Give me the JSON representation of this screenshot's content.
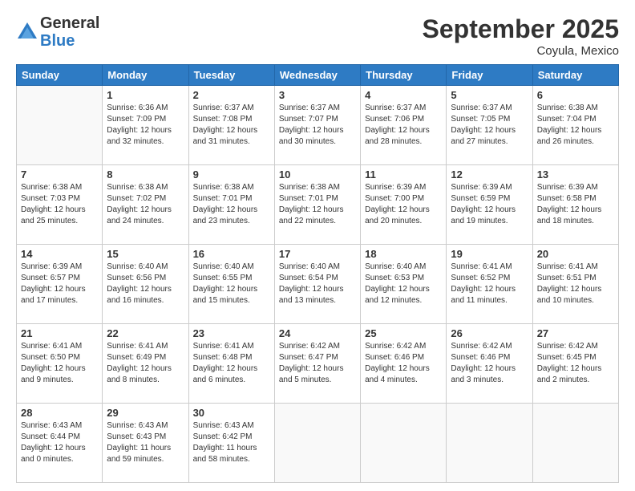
{
  "logo": {
    "general": "General",
    "blue": "Blue"
  },
  "header": {
    "month": "September 2025",
    "location": "Coyula, Mexico"
  },
  "weekdays": [
    "Sunday",
    "Monday",
    "Tuesday",
    "Wednesday",
    "Thursday",
    "Friday",
    "Saturday"
  ],
  "weeks": [
    [
      {
        "day": null,
        "info": null
      },
      {
        "day": "1",
        "info": "Sunrise: 6:36 AM\nSunset: 7:09 PM\nDaylight: 12 hours\nand 32 minutes."
      },
      {
        "day": "2",
        "info": "Sunrise: 6:37 AM\nSunset: 7:08 PM\nDaylight: 12 hours\nand 31 minutes."
      },
      {
        "day": "3",
        "info": "Sunrise: 6:37 AM\nSunset: 7:07 PM\nDaylight: 12 hours\nand 30 minutes."
      },
      {
        "day": "4",
        "info": "Sunrise: 6:37 AM\nSunset: 7:06 PM\nDaylight: 12 hours\nand 28 minutes."
      },
      {
        "day": "5",
        "info": "Sunrise: 6:37 AM\nSunset: 7:05 PM\nDaylight: 12 hours\nand 27 minutes."
      },
      {
        "day": "6",
        "info": "Sunrise: 6:38 AM\nSunset: 7:04 PM\nDaylight: 12 hours\nand 26 minutes."
      }
    ],
    [
      {
        "day": "7",
        "info": "Sunrise: 6:38 AM\nSunset: 7:03 PM\nDaylight: 12 hours\nand 25 minutes."
      },
      {
        "day": "8",
        "info": "Sunrise: 6:38 AM\nSunset: 7:02 PM\nDaylight: 12 hours\nand 24 minutes."
      },
      {
        "day": "9",
        "info": "Sunrise: 6:38 AM\nSunset: 7:01 PM\nDaylight: 12 hours\nand 23 minutes."
      },
      {
        "day": "10",
        "info": "Sunrise: 6:38 AM\nSunset: 7:01 PM\nDaylight: 12 hours\nand 22 minutes."
      },
      {
        "day": "11",
        "info": "Sunrise: 6:39 AM\nSunset: 7:00 PM\nDaylight: 12 hours\nand 20 minutes."
      },
      {
        "day": "12",
        "info": "Sunrise: 6:39 AM\nSunset: 6:59 PM\nDaylight: 12 hours\nand 19 minutes."
      },
      {
        "day": "13",
        "info": "Sunrise: 6:39 AM\nSunset: 6:58 PM\nDaylight: 12 hours\nand 18 minutes."
      }
    ],
    [
      {
        "day": "14",
        "info": "Sunrise: 6:39 AM\nSunset: 6:57 PM\nDaylight: 12 hours\nand 17 minutes."
      },
      {
        "day": "15",
        "info": "Sunrise: 6:40 AM\nSunset: 6:56 PM\nDaylight: 12 hours\nand 16 minutes."
      },
      {
        "day": "16",
        "info": "Sunrise: 6:40 AM\nSunset: 6:55 PM\nDaylight: 12 hours\nand 15 minutes."
      },
      {
        "day": "17",
        "info": "Sunrise: 6:40 AM\nSunset: 6:54 PM\nDaylight: 12 hours\nand 13 minutes."
      },
      {
        "day": "18",
        "info": "Sunrise: 6:40 AM\nSunset: 6:53 PM\nDaylight: 12 hours\nand 12 minutes."
      },
      {
        "day": "19",
        "info": "Sunrise: 6:41 AM\nSunset: 6:52 PM\nDaylight: 12 hours\nand 11 minutes."
      },
      {
        "day": "20",
        "info": "Sunrise: 6:41 AM\nSunset: 6:51 PM\nDaylight: 12 hours\nand 10 minutes."
      }
    ],
    [
      {
        "day": "21",
        "info": "Sunrise: 6:41 AM\nSunset: 6:50 PM\nDaylight: 12 hours\nand 9 minutes."
      },
      {
        "day": "22",
        "info": "Sunrise: 6:41 AM\nSunset: 6:49 PM\nDaylight: 12 hours\nand 8 minutes."
      },
      {
        "day": "23",
        "info": "Sunrise: 6:41 AM\nSunset: 6:48 PM\nDaylight: 12 hours\nand 6 minutes."
      },
      {
        "day": "24",
        "info": "Sunrise: 6:42 AM\nSunset: 6:47 PM\nDaylight: 12 hours\nand 5 minutes."
      },
      {
        "day": "25",
        "info": "Sunrise: 6:42 AM\nSunset: 6:46 PM\nDaylight: 12 hours\nand 4 minutes."
      },
      {
        "day": "26",
        "info": "Sunrise: 6:42 AM\nSunset: 6:46 PM\nDaylight: 12 hours\nand 3 minutes."
      },
      {
        "day": "27",
        "info": "Sunrise: 6:42 AM\nSunset: 6:45 PM\nDaylight: 12 hours\nand 2 minutes."
      }
    ],
    [
      {
        "day": "28",
        "info": "Sunrise: 6:43 AM\nSunset: 6:44 PM\nDaylight: 12 hours\nand 0 minutes."
      },
      {
        "day": "29",
        "info": "Sunrise: 6:43 AM\nSunset: 6:43 PM\nDaylight: 11 hours\nand 59 minutes."
      },
      {
        "day": "30",
        "info": "Sunrise: 6:43 AM\nSunset: 6:42 PM\nDaylight: 11 hours\nand 58 minutes."
      },
      {
        "day": null,
        "info": null
      },
      {
        "day": null,
        "info": null
      },
      {
        "day": null,
        "info": null
      },
      {
        "day": null,
        "info": null
      }
    ]
  ]
}
